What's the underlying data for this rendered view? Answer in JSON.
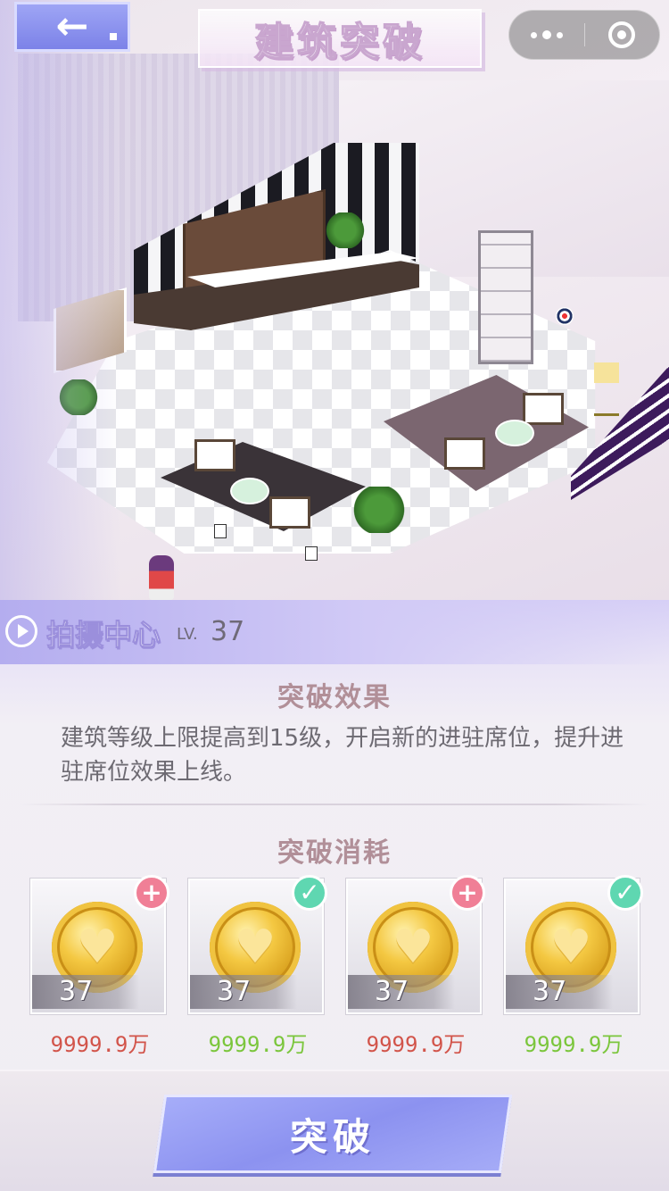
{
  "header": {
    "back_icon": "back-arrow-icon",
    "title": "建筑突破"
  },
  "capsule": {
    "more_icon": "more-dots-icon",
    "close_icon": "close-target-icon"
  },
  "building": {
    "name": "拍摄中心",
    "level_prefix": "LV.",
    "level": "37"
  },
  "effect": {
    "title": "突破效果",
    "text": "建筑等级上限提高到15级，开启新的进驻席位，提升进驻席位效果上线。"
  },
  "cost": {
    "title": "突破消耗",
    "items": [
      {
        "icon": "gold-heart-coin-icon",
        "count": "37",
        "badge": "plus",
        "price": "9999.9万",
        "price_color": "#d2544a"
      },
      {
        "icon": "gold-heart-coin-icon",
        "count": "37",
        "badge": "check",
        "price": "9999.9万",
        "price_color": "#7bc63c"
      },
      {
        "icon": "gold-heart-coin-icon",
        "count": "37",
        "badge": "plus",
        "price": "9999.9万",
        "price_color": "#d2544a"
      },
      {
        "icon": "gold-heart-coin-icon",
        "count": "37",
        "badge": "check",
        "price": "9999.9万",
        "price_color": "#7bc63c"
      }
    ]
  },
  "action": {
    "button_label": "突破"
  },
  "colors": {
    "accent": "#8c92f0",
    "section_title": "#b18f98",
    "insufficient": "#d2544a",
    "sufficient": "#7bc63c"
  }
}
